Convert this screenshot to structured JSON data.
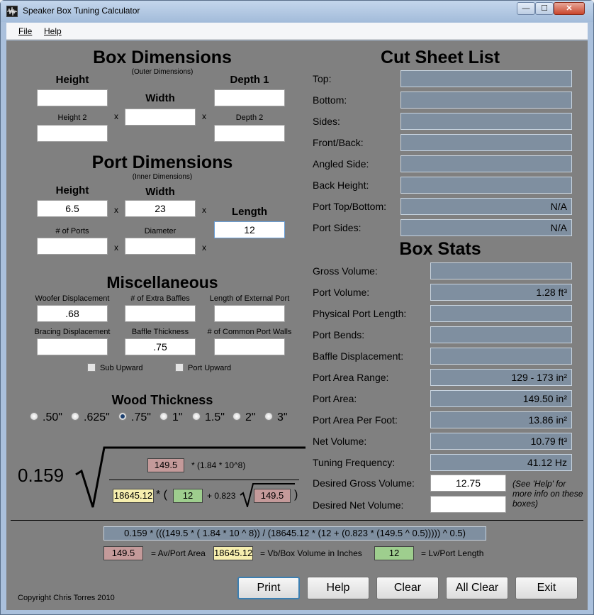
{
  "window": {
    "title": "Speaker Box Tuning Calculator",
    "controls": {
      "minimize": "—",
      "maximize": "☐",
      "close": "✕"
    }
  },
  "menu": {
    "file": "File",
    "help": "Help"
  },
  "box": {
    "heading": "Box Dimensions",
    "subheading": "(Outer Dimensions)",
    "height_label": "Height",
    "width_label": "Width",
    "depth1_label": "Depth 1",
    "height2_label": "Height 2",
    "depth2_label": "Depth 2",
    "times": "x",
    "height": "",
    "height2": "",
    "width": "",
    "depth1": "",
    "depth2": ""
  },
  "port": {
    "heading": "Port Dimensions",
    "subheading": "(Inner Dimensions)",
    "height_label": "Height",
    "width_label": "Width",
    "length_label": "Length",
    "ports_label": "# of Ports",
    "diameter_label": "Diameter",
    "height": "6.5",
    "width": "23",
    "length": "12",
    "ports": "",
    "diameter": ""
  },
  "misc": {
    "heading": "Miscellaneous",
    "woofer_label": "Woofer Displacement",
    "extra_baffles_label": "# of Extra Baffles",
    "ext_port_label": "Length of External Port",
    "bracing_label": "Bracing Displacement",
    "baffle_thickness_label": "Baffle Thickness",
    "common_walls_label": "# of Common Port Walls",
    "woofer": ".68",
    "extra_baffles": "",
    "ext_port": "",
    "bracing": "",
    "baffle_thickness": ".75",
    "common_walls": "",
    "sub_upward": "Sub Upward",
    "port_upward": "Port Upward"
  },
  "wood": {
    "heading": "Wood Thickness",
    "options": [
      ".50\"",
      ".625\"",
      ".75\"",
      "1\"",
      "1.5\"",
      "2\"",
      "3\""
    ],
    "selected": ".75\""
  },
  "cut_sheet": {
    "heading": "Cut Sheet List",
    "rows": [
      {
        "label": "Top:",
        "value": ""
      },
      {
        "label": "Bottom:",
        "value": ""
      },
      {
        "label": "Sides:",
        "value": ""
      },
      {
        "label": "Front/Back:",
        "value": ""
      },
      {
        "label": "Angled Side:",
        "value": ""
      },
      {
        "label": "Back Height:",
        "value": ""
      },
      {
        "label": "Port Top/Bottom:",
        "value": "N/A"
      },
      {
        "label": "Port Sides:",
        "value": "N/A"
      }
    ]
  },
  "stats": {
    "heading": "Box Stats",
    "rows": [
      {
        "label": "Gross Volume:",
        "value": ""
      },
      {
        "label": "Port Volume:",
        "value": "1.28 ft³"
      },
      {
        "label": "Physical Port Length:",
        "value": ""
      },
      {
        "label": "Port Bends:",
        "value": ""
      },
      {
        "label": "Baffle Displacement:",
        "value": ""
      },
      {
        "label": "Port Area Range:",
        "value": "129 - 173 in²"
      },
      {
        "label": "Port Area:",
        "value": "149.50 in²"
      },
      {
        "label": "Port Area Per Foot:",
        "value": "13.86 in²"
      },
      {
        "label": "Net Volume:",
        "value": "10.79 ft³"
      },
      {
        "label": "Tuning Frequency:",
        "value": "41.12 Hz"
      }
    ],
    "desired_gross_label": "Desired Gross Volume:",
    "desired_gross": "12.75",
    "desired_net_label": "Desired Net Volume:",
    "desired_net": "",
    "note": "(See 'Help' for more info on these boxes)"
  },
  "formula": {
    "constant": "0.159",
    "radical": "√",
    "av": "149.5",
    "numerator_text": "* (1.84 * 10^8)",
    "vb": "18645.12",
    "star_paren": "* (",
    "lv": "12",
    "plus": "+ 0.823",
    "close_paren": ")",
    "expression": "0.159 * (((149.5 * ( 1.84 * 10 ^ 8)) / (18645.12 * (12 + (0.823 * (149.5 ^ 0.5))))) ^ 0.5)"
  },
  "legend": {
    "av_value": "149.5",
    "av_text": "= Av/Port Area",
    "vb_value": "18645.12",
    "vb_text": "= Vb/Box Volume in Inches",
    "lv_value": "12",
    "lv_text": "= Lv/Port Length"
  },
  "buttons": {
    "print": "Print",
    "help": "Help",
    "clear": "Clear",
    "all_clear": "All Clear",
    "exit": "Exit"
  },
  "copyright": "Copyright Chris Torres 2010"
}
